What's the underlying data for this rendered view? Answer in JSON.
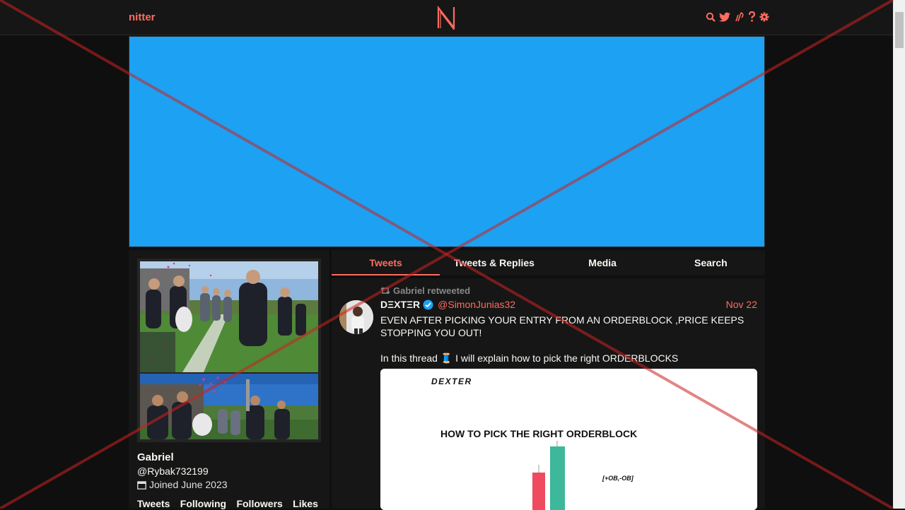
{
  "nav": {
    "brand": "nitter",
    "logo_letter": "N",
    "icons": [
      "search-icon",
      "twitter-bird-icon",
      "rss-icon",
      "help-icon",
      "gear-icon"
    ]
  },
  "profile": {
    "fullname": "Gabriel",
    "username": "@Rybak732199",
    "joined": "Joined June 2023",
    "stats": [
      "Tweets",
      "Following",
      "Followers",
      "Likes"
    ]
  },
  "tabs": [
    {
      "label": "Tweets",
      "active": true
    },
    {
      "label": "Tweets & Replies",
      "active": false
    },
    {
      "label": "Media",
      "active": false
    },
    {
      "label": "Search",
      "active": false
    }
  ],
  "tweet": {
    "retweet_label": "Gabriel retweeted",
    "name": "DΞXTΞR",
    "handle": "@SimonJunias32",
    "date": "Nov 22",
    "body_1": "EVEN AFTER PICKING YOUR ENTRY FROM AN ORDERBLOCK ,PRICE KEEPS STOPPING YOU OUT!",
    "body_2": "In this thread 🧵 I will explain how to pick the right ORDERBLOCKS",
    "image": {
      "watermark": "DEXTER",
      "title": "HOW TO PICK THE RIGHT ORDERBLOCK",
      "annotation": "[+OB,-OB]"
    }
  },
  "colors": {
    "accent": "#ff6c60",
    "banner": "#1da1f2",
    "background": "#0f0f0f",
    "panel": "#161616",
    "candle_bear": "#ef4a5f",
    "candle_bull": "#3db89a"
  }
}
